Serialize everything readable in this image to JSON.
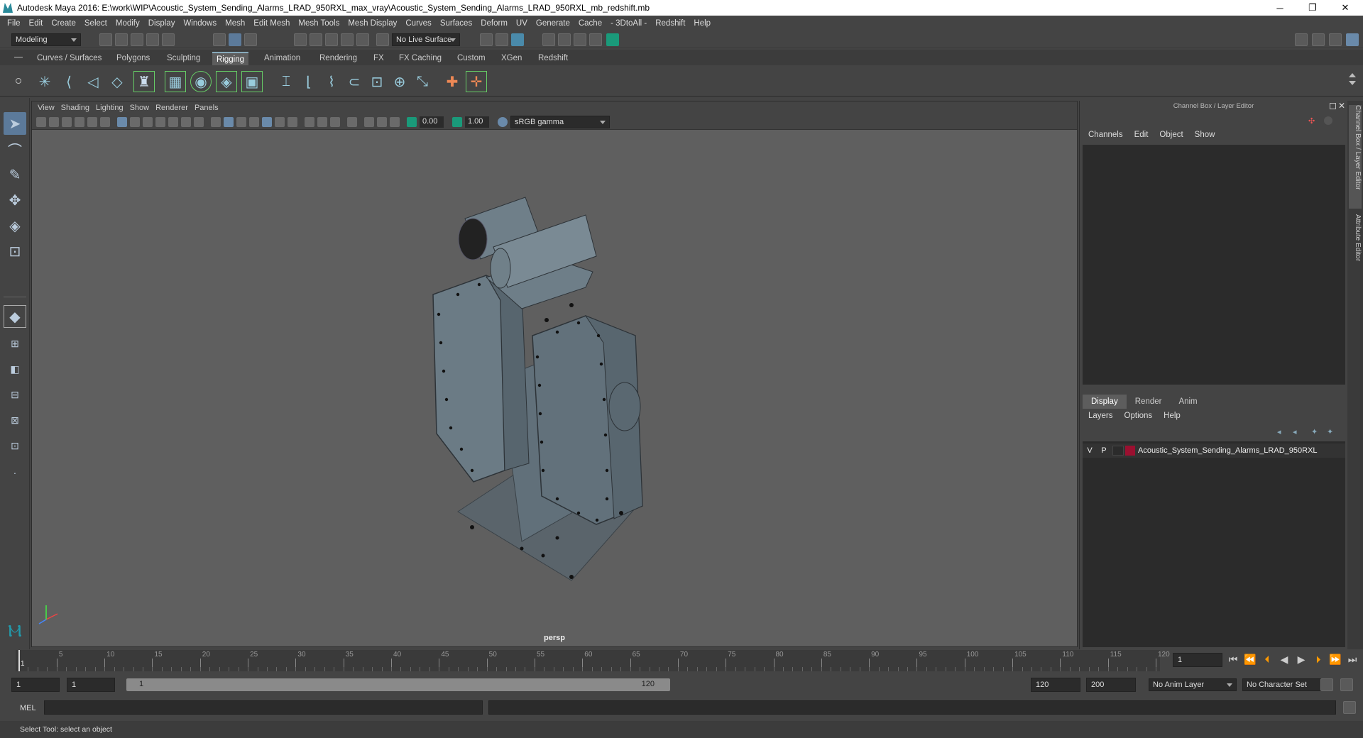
{
  "titlebar": {
    "title": "Autodesk Maya 2016: E:\\work\\WIP\\Acoustic_System_Sending_Alarms_LRAD_950RXL_max_vray\\Acoustic_System_Sending_Alarms_LRAD_950RXL_mb_redshift.mb",
    "minimize": "─",
    "restore": "❐",
    "close": "✕"
  },
  "menubar": [
    "File",
    "Edit",
    "Create",
    "Select",
    "Modify",
    "Display",
    "Windows",
    "Mesh",
    "Edit Mesh",
    "Mesh Tools",
    "Mesh Display",
    "Curves",
    "Surfaces",
    "Deform",
    "UV",
    "Generate",
    "Cache",
    "- 3DtoAll -",
    "Redshift",
    "Help"
  ],
  "statusline": {
    "mode": "Modeling",
    "live_surface": "No Live Surface"
  },
  "shelf_tabs": [
    {
      "label": "Curves / Surfaces",
      "active": false
    },
    {
      "label": "Polygons",
      "active": false
    },
    {
      "label": "Sculpting",
      "active": false
    },
    {
      "label": "Rigging",
      "active": true
    },
    {
      "label": "Animation",
      "active": false
    },
    {
      "label": "Rendering",
      "active": false
    },
    {
      "label": "FX",
      "active": false
    },
    {
      "label": "FX Caching",
      "active": false
    },
    {
      "label": "Custom",
      "active": false
    },
    {
      "label": "XGen",
      "active": false
    },
    {
      "label": "Redshift",
      "active": false
    }
  ],
  "viewport": {
    "menu": [
      "View",
      "Shading",
      "Lighting",
      "Show",
      "Renderer",
      "Panels"
    ],
    "near_value": "0.00",
    "far_value": "1.00",
    "color_space": "sRGB gamma",
    "camera_label": "persp"
  },
  "right_panel": {
    "title": "Channel Box / Layer Editor",
    "channel_menu": [
      "Channels",
      "Edit",
      "Object",
      "Show"
    ],
    "layer_tabs": [
      {
        "label": "Display",
        "active": true
      },
      {
        "label": "Render",
        "active": false
      },
      {
        "label": "Anim",
        "active": false
      }
    ],
    "layer_menu": [
      "Layers",
      "Options",
      "Help"
    ],
    "layer": {
      "visible": "V",
      "playback": "P",
      "name": "Acoustic_System_Sending_Alarms_LRAD_950RXL",
      "color": "#9b1030"
    }
  },
  "side_tabs": [
    "Channel Box / Layer Editor",
    "Attribute Editor"
  ],
  "timeline": {
    "ticks": [
      "1",
      "5",
      "10",
      "15",
      "20",
      "25",
      "30",
      "35",
      "40",
      "45",
      "50",
      "55",
      "60",
      "65",
      "70",
      "75",
      "80",
      "85",
      "90",
      "95",
      "100",
      "105",
      "110",
      "115",
      "120"
    ],
    "current_frame": "1"
  },
  "range": {
    "start": "1",
    "playback_start": "1",
    "range_start": "1",
    "range_end": "120",
    "playback_end": "120",
    "end": "200",
    "anim_layer": "No Anim Layer",
    "character_set": "No Character Set"
  },
  "cmdline": {
    "label": "MEL"
  },
  "helpline": {
    "text": "Select Tool: select an object"
  }
}
